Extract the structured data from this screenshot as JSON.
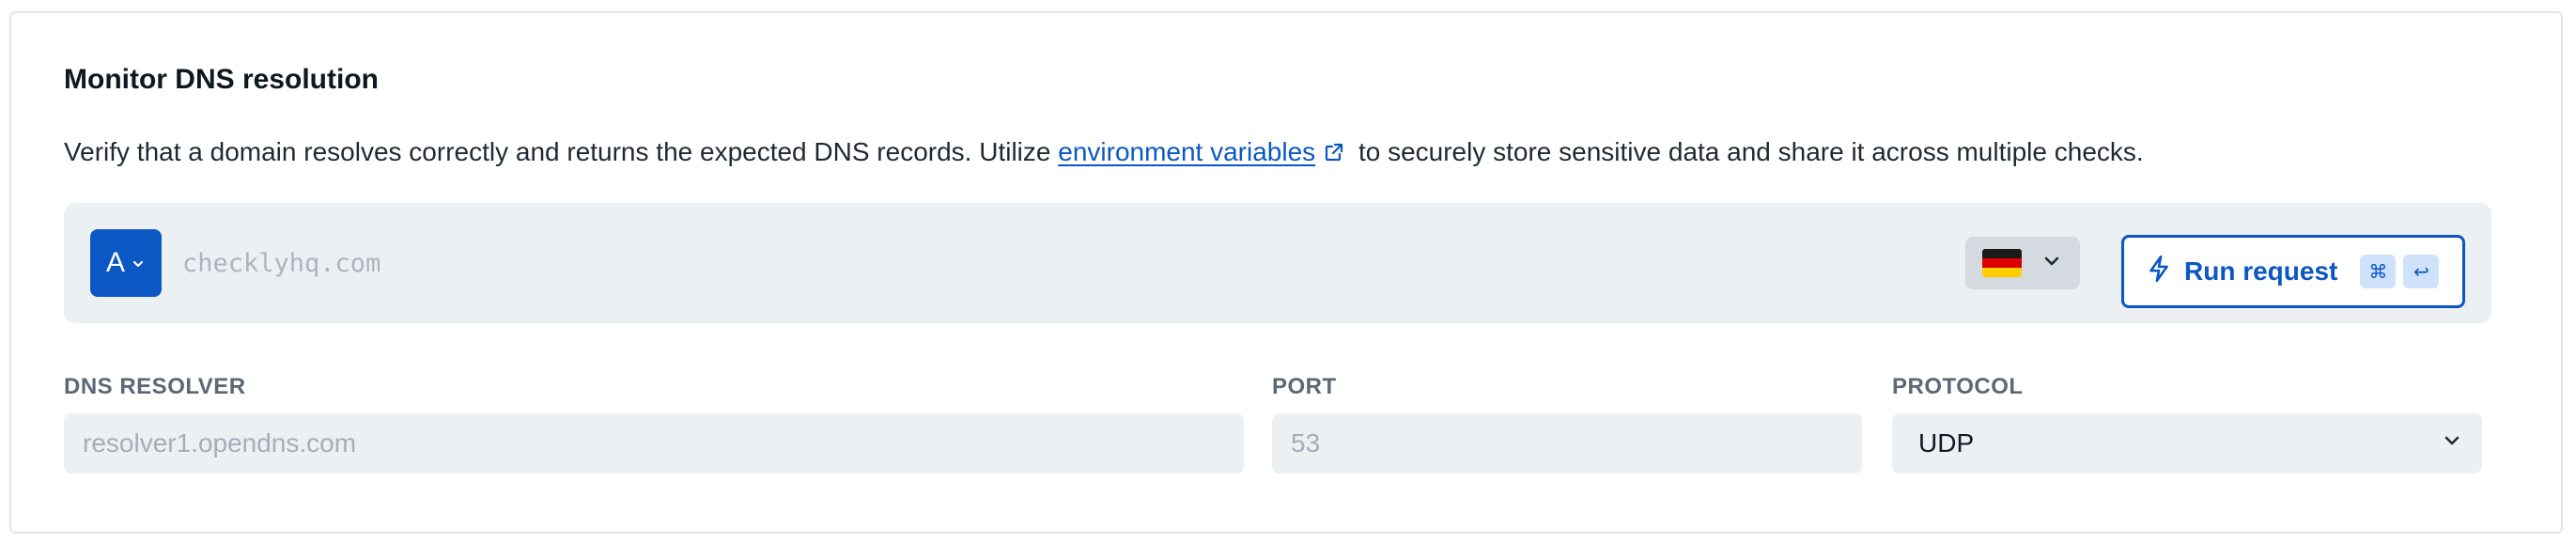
{
  "title": "Monitor DNS resolution",
  "description": {
    "before": "Verify that a domain resolves correctly and returns the expected DNS records. Utilize ",
    "link": "environment variables",
    "after": " to securely store sensitive data and share it across multiple checks."
  },
  "request": {
    "record_type": "A",
    "url_placeholder": "checklyhq.com",
    "region_flag": "germany-flag",
    "run_label": "Run request",
    "shortcut_cmd": "⌘",
    "shortcut_enter": "↩"
  },
  "fields": {
    "resolver": {
      "label": "DNS RESOLVER",
      "placeholder": "resolver1.opendns.com"
    },
    "port": {
      "label": "PORT",
      "placeholder": "53"
    },
    "protocol": {
      "label": "PROTOCOL",
      "value": "UDP"
    }
  },
  "colors": {
    "accent": "#0b57c4",
    "panel_bg": "#edf0f3"
  }
}
